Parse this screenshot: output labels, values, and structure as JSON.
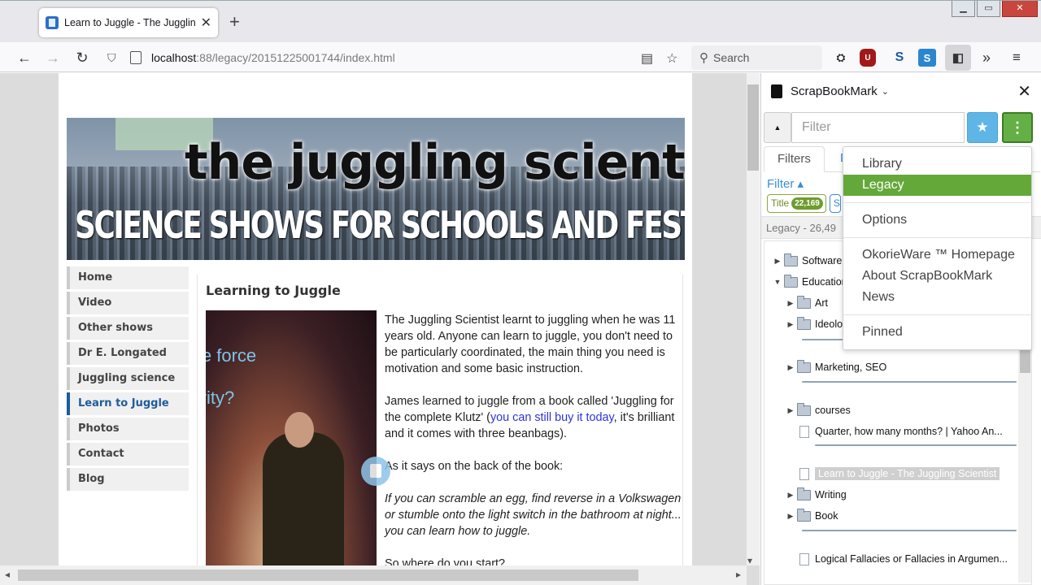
{
  "browser": {
    "tab_title": "Learn to Juggle - The Juggling S",
    "url_host": "localhost",
    "url_rest": ":88/legacy/20151225001744/index.html",
    "search_placeholder": "Search"
  },
  "page": {
    "banner_title": "the juggling scientist",
    "banner_subtitle": "SCIENCE SHOWS FOR SCHOOLS AND FESTIVALS",
    "nav": [
      {
        "label": "Home"
      },
      {
        "label": "Video"
      },
      {
        "label": "Other shows"
      },
      {
        "label": "Dr E. Longated"
      },
      {
        "label": "Juggling science"
      },
      {
        "label": "Learn to Juggle",
        "active": true
      },
      {
        "label": "Photos"
      },
      {
        "label": "Contact"
      },
      {
        "label": "Blog"
      }
    ],
    "heading": "Learning to Juggle",
    "photo_slide_text_1": "le force",
    "photo_slide_text_2": "vity?",
    "p1": "The Juggling Scientist learnt to juggling when he was 11 years old. Anyone can learn to juggle, you don't need to be particularly coordinated, the main thing you need is motivation and some basic instruction.",
    "p2_before": "James learned to juggle from a book called 'Juggling for the complete Klutz' (",
    "p2_link": "you can still buy it today",
    "p2_after": ", it's brilliant and it comes with three beanbags).",
    "p3": "As it says on the back of the book:",
    "p4": "If you can scramble an egg, find reverse in a Volkswagen or stumble onto the light switch in the bathroom at night... you can learn how to juggle.",
    "p5": "So where do you start?"
  },
  "sidebar": {
    "title": "ScrapBookMark",
    "filter_placeholder": "Filter",
    "tabs": [
      "Filters",
      "D"
    ],
    "filter_label": "Filter ▴",
    "chip_label": "Title",
    "chip_count": "22,169",
    "chip2_label": "S",
    "status": "Legacy - 26,49",
    "tree": [
      {
        "label": "Software",
        "type": "folder",
        "toggle": "▶"
      },
      {
        "label": "Education",
        "type": "folder",
        "toggle": "▼"
      },
      {
        "label": "Art",
        "type": "folder",
        "toggle": "▶"
      },
      {
        "label": "Ideolo",
        "type": "folder",
        "toggle": "▶"
      },
      {
        "label": "Marketing, SEO",
        "type": "folder",
        "toggle": "▶"
      },
      {
        "label": "courses",
        "type": "folder",
        "toggle": "▶"
      },
      {
        "label": "Quarter, how many months? | Yahoo An...",
        "type": "file"
      },
      {
        "label": "Learn to Juggle - The Juggling Scientist",
        "type": "file",
        "selected": true
      },
      {
        "label": "Writing",
        "type": "folder",
        "toggle": "▶"
      },
      {
        "label": "Book",
        "type": "folder",
        "toggle": "▶"
      },
      {
        "label": "Logical Fallacies or Fallacies in Argumen...",
        "type": "file"
      }
    ]
  },
  "menu": {
    "items": [
      "Library",
      "Legacy",
      "Options",
      "OkorieWare ™ Homepage",
      "About ScrapBookMark",
      "News",
      "Pinned"
    ]
  },
  "colors": {
    "menu_active": "#64a839",
    "nav_active": "#1e5c9c",
    "link": "#2b34d9"
  }
}
